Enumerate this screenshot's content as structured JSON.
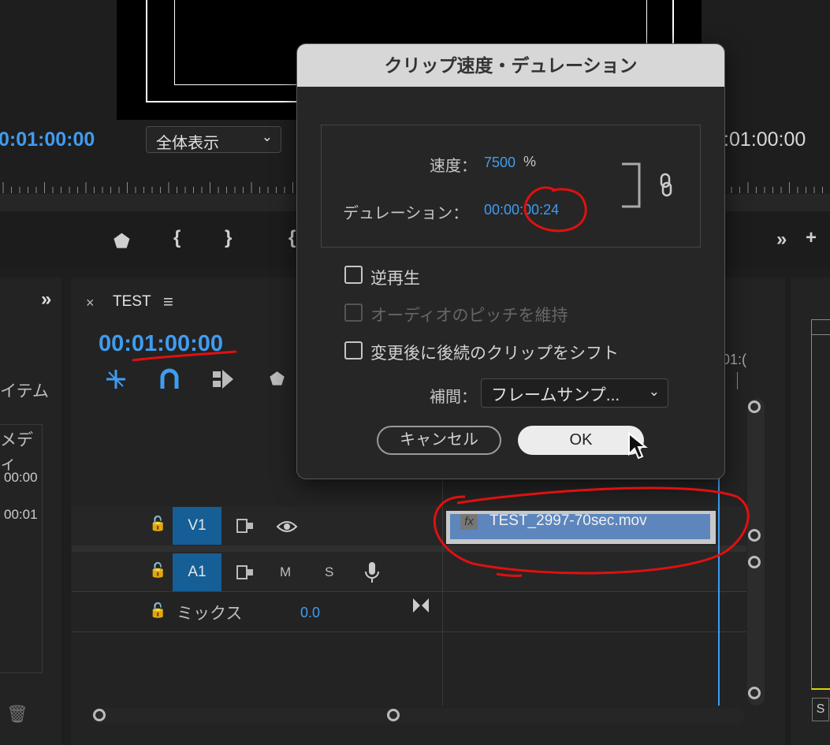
{
  "monitor": {
    "timecode_left": "0:01:00:00",
    "timecode_right": ":01:00:00",
    "zoom_select": "全体表示"
  },
  "left_panel": {
    "item_label": "イテム",
    "media_label": "メディ",
    "rows": [
      "00:00",
      "00:01"
    ]
  },
  "timeline": {
    "sequence_name": "TEST",
    "timecode": "00:01:00:00",
    "ruler_label": "01:(",
    "tracks": {
      "v1": "V1",
      "a1": "A1",
      "mute": "M",
      "solo": "S",
      "mix_label": "ミックス",
      "mix_value": "0.0"
    },
    "clip": {
      "fx": "fx",
      "name": "TEST_2997-70sec.mov"
    }
  },
  "right_panel": {
    "label": "S"
  },
  "dialog": {
    "title": "クリップ速度・デュレーション",
    "speed_label": "速度：",
    "speed_value": "7500",
    "speed_unit": "%",
    "duration_label": "デュレーション：",
    "duration_value": "00:00:00:24",
    "reverse": {
      "label": "逆再生",
      "checked": false
    },
    "maintain_pitch": {
      "label": "オーディオのピッチを維持",
      "checked": false,
      "enabled": false
    },
    "ripple": {
      "label": "変更後に後続のクリップをシフト",
      "checked": false
    },
    "interp_label": "補間：",
    "interp_value": "フレームサンプ...",
    "cancel_label": "キャンセル",
    "ok_label": "OK"
  },
  "colors": {
    "accent": "#3f9cf0",
    "track_tag": "#155f96",
    "clip": "#5d86bd",
    "annotation": "#e01010"
  }
}
